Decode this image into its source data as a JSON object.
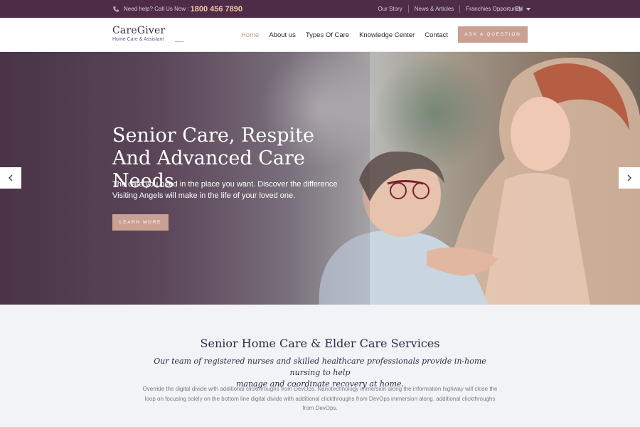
{
  "topbar": {
    "help_text": "Need help? Call Us Now :",
    "phone": "1800 456 7890",
    "links": [
      "Our Story",
      "News & Articles",
      "Franchies Opportunity"
    ],
    "language": "EN"
  },
  "header": {
    "brand": "CareGiver",
    "tagline": "Home Care & Assistant",
    "nav": [
      "Home",
      "About us",
      "Types Of Care",
      "Knowledge Center",
      "Contact"
    ],
    "active_nav": "Home",
    "cta": "ASK A QUESTION"
  },
  "hero": {
    "title_line1": "Senior Care, Respite",
    "title_line2": "And Advanced Care Needs",
    "subtitle_line1": "The care you need in the place you want. Discover the difference",
    "subtitle_line2": "Visiting Angels will make in the life of your loved one.",
    "button": "LEARN MORE",
    "prev_icon": "chevron-left-icon",
    "next_icon": "chevron-right-icon"
  },
  "services": {
    "heading": "Senior Home Care & Elder Care Services",
    "lead_line1": "Our team of registered nurses and skilled healthcare professionals provide in-home nursing to help",
    "lead_line2": "manage and coordinate recovery at home.",
    "body": "Override the digital divide with additional clickthroughs from DevOps. Nanotechnology immersion along the information highway will close the loop on focusing solely on the bottom line digital divide with additional clickthroughs from DevOps immersion along. additional clickthroughs from DevOps."
  },
  "colors": {
    "topbar_bg": "#4e2b47",
    "accent": "#c9a091",
    "phone": "#f1c8a3",
    "heading": "#2b2b45"
  }
}
